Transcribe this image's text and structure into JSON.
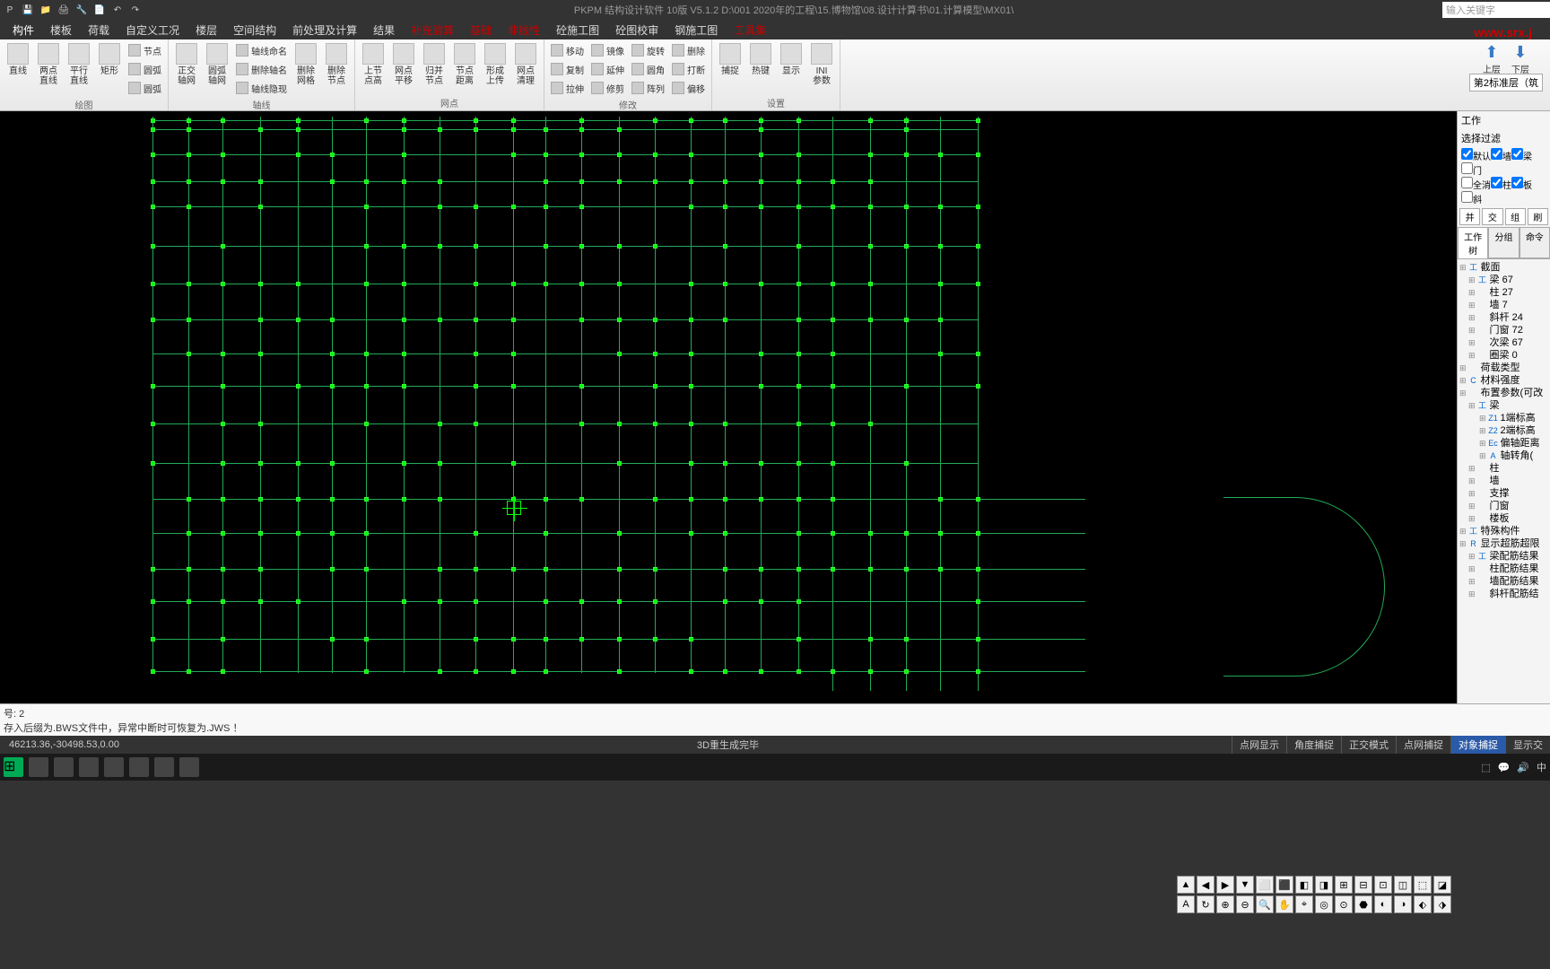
{
  "titlebar": {
    "title": "PKPM 结构设计软件 10版 V5.1.2 D:\\001 2020年的工程\\15.博物馆\\08.设计计算书\\01.计算模型\\MX01\\",
    "search_placeholder": "输入关键字"
  },
  "watermark": "www.srx.j",
  "menu": [
    "构件",
    "楼板",
    "荷载",
    "自定义工况",
    "楼层",
    "空间结构",
    "前处理及计算",
    "结果",
    "补充验算",
    "基础",
    "非线性",
    "砼施工图",
    "砼图校审",
    "钢施工图",
    "工具集"
  ],
  "ribbon": {
    "groups": [
      {
        "label": "绘图",
        "items": [
          {
            "type": "big",
            "label": "直线"
          },
          {
            "type": "big",
            "label": "两点\n直线"
          },
          {
            "type": "big",
            "label": "平行\n直线"
          },
          {
            "type": "big",
            "label": "矩形"
          },
          {
            "type": "smallcol",
            "items": [
              "节点",
              "圆弧",
              "圆弧"
            ]
          }
        ]
      },
      {
        "label": "轴线",
        "items": [
          {
            "type": "big",
            "label": "正交\n轴网"
          },
          {
            "type": "big",
            "label": "圆弧\n轴网"
          },
          {
            "type": "smallcol",
            "items": [
              "轴线命名",
              "删除轴名",
              "轴线隐现"
            ]
          },
          {
            "type": "big",
            "label": "删除\n网格"
          },
          {
            "type": "big",
            "label": "删除\n节点"
          }
        ]
      },
      {
        "label": "网点",
        "items": [
          {
            "type": "big",
            "label": "上节\n点高"
          },
          {
            "type": "big",
            "label": "网点\n平移"
          },
          {
            "type": "big",
            "label": "归并\n节点"
          },
          {
            "type": "big",
            "label": "节点\n距离"
          },
          {
            "type": "big",
            "label": "形成\n上传"
          },
          {
            "type": "big",
            "label": "网点\n清理"
          }
        ]
      },
      {
        "label": "修改",
        "items": [
          {
            "type": "smallcol",
            "items": [
              "移动",
              "复制",
              "拉伸"
            ]
          },
          {
            "type": "smallcol",
            "items": [
              "镜像",
              "延伸",
              "修剪"
            ]
          },
          {
            "type": "smallcol",
            "items": [
              "旋转",
              "圆角",
              "阵列"
            ]
          },
          {
            "type": "smallcol",
            "items": [
              "删除",
              "打断",
              "偏移"
            ]
          }
        ]
      },
      {
        "label": "设置",
        "items": [
          {
            "type": "big",
            "label": "捕捉"
          },
          {
            "type": "big",
            "label": "热键"
          },
          {
            "type": "big",
            "label": "显示"
          },
          {
            "type": "big",
            "label": "INI\n参数"
          }
        ]
      }
    ],
    "floor": {
      "up": "上层",
      "down": "下层",
      "current": "第2标准层（筑"
    }
  },
  "rightpanel": {
    "title": "工作",
    "filter_label": "选择过滤",
    "filters": [
      {
        "label": "默认",
        "checked": true
      },
      {
        "label": "墙",
        "checked": true
      },
      {
        "label": "梁",
        "checked": true
      },
      {
        "label": "门",
        "checked": false
      },
      {
        "label": "全消",
        "checked": false
      },
      {
        "label": "柱",
        "checked": true
      },
      {
        "label": "板",
        "checked": true
      },
      {
        "label": "斜",
        "checked": false
      }
    ],
    "btns": [
      "并",
      "交",
      "组",
      "刷"
    ],
    "tabs": [
      "工作树",
      "分组",
      "命令"
    ],
    "tree": [
      {
        "lvl": 0,
        "icon": "工",
        "text": "截面"
      },
      {
        "lvl": 1,
        "icon": "工",
        "text": "梁 67"
      },
      {
        "lvl": 1,
        "icon": "",
        "text": "柱 27"
      },
      {
        "lvl": 1,
        "icon": "",
        "text": "墙 7"
      },
      {
        "lvl": 1,
        "icon": "",
        "text": "斜杆 24"
      },
      {
        "lvl": 1,
        "icon": "",
        "text": "门窗 72"
      },
      {
        "lvl": 1,
        "icon": "",
        "text": "次梁 67"
      },
      {
        "lvl": 1,
        "icon": "",
        "text": "圈梁 0"
      },
      {
        "lvl": 0,
        "icon": "",
        "text": "荷载类型"
      },
      {
        "lvl": 0,
        "icon": "C",
        "text": "材料强度"
      },
      {
        "lvl": 0,
        "icon": "",
        "text": "布置参数(可改"
      },
      {
        "lvl": 1,
        "icon": "工",
        "text": "梁"
      },
      {
        "lvl": 2,
        "icon": "Z1",
        "text": "1端标高"
      },
      {
        "lvl": 2,
        "icon": "Z2",
        "text": "2端标高"
      },
      {
        "lvl": 2,
        "icon": "Ec",
        "text": "偏轴距离"
      },
      {
        "lvl": 2,
        "icon": "A",
        "text": "轴转角("
      },
      {
        "lvl": 1,
        "icon": "",
        "text": "柱"
      },
      {
        "lvl": 1,
        "icon": "",
        "text": "墙"
      },
      {
        "lvl": 1,
        "icon": "",
        "text": "支撑"
      },
      {
        "lvl": 1,
        "icon": "",
        "text": "门窗"
      },
      {
        "lvl": 1,
        "icon": "",
        "text": "楼板"
      },
      {
        "lvl": 0,
        "icon": "工",
        "text": "特殊构件"
      },
      {
        "lvl": 0,
        "icon": "R",
        "text": "显示超筋超限"
      },
      {
        "lvl": 1,
        "icon": "工",
        "text": "梁配筋结果"
      },
      {
        "lvl": 1,
        "icon": "",
        "text": "柱配筋结果"
      },
      {
        "lvl": 1,
        "icon": "",
        "text": "墙配筋结果"
      },
      {
        "lvl": 1,
        "icon": "",
        "text": "斜杆配筋结"
      }
    ]
  },
  "cmdline": {
    "line1": "号:    2",
    "line2": "存入后缀为.BWS文件中，异常中断时可恢复为.JWS ！"
  },
  "statusbar": {
    "coords": "46213.36,-30498.53,0.00",
    "center": "3D重生成完毕",
    "toggles": [
      "点网显示",
      "角度捕捉",
      "正交模式",
      "点网捕捉",
      "对象捕捉",
      "显示交"
    ]
  },
  "taskbar": {
    "right": [
      "⬚",
      "🔊",
      "中"
    ]
  }
}
